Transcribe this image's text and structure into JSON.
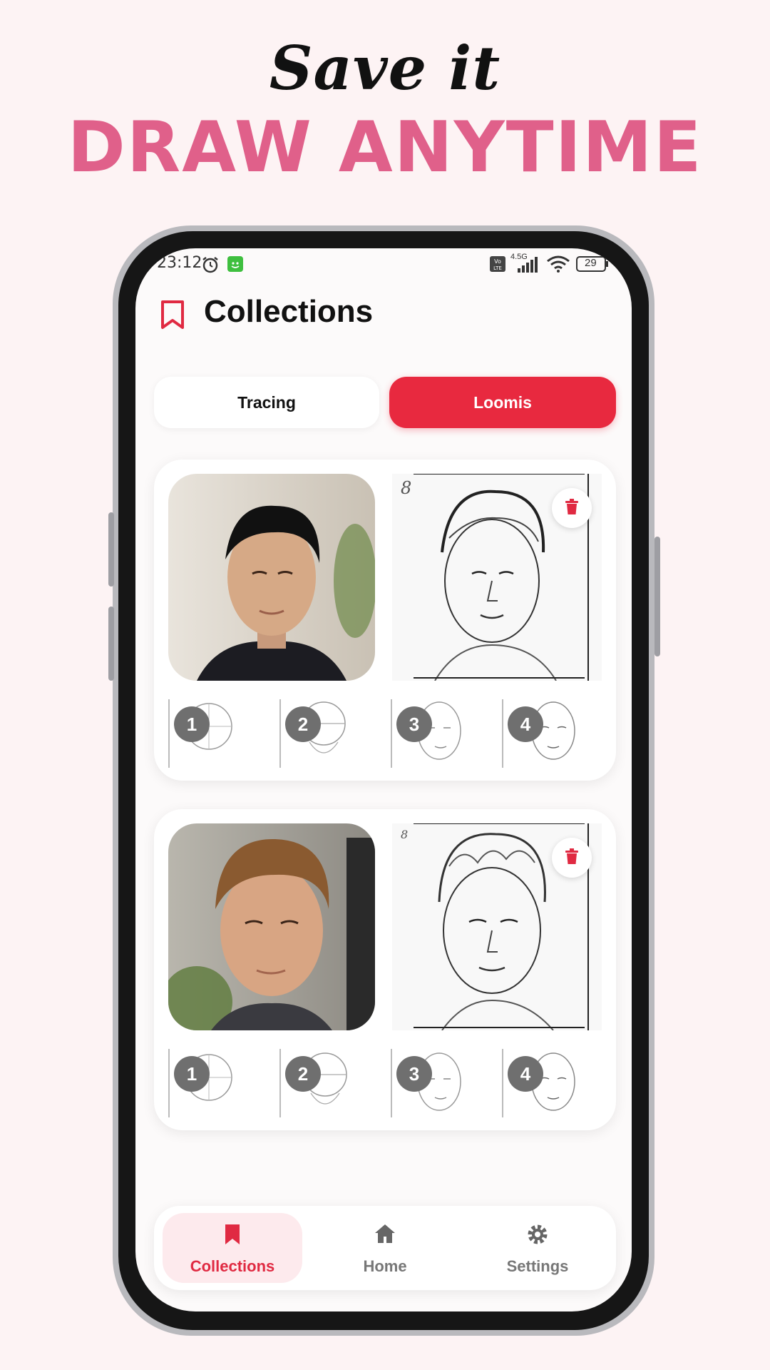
{
  "hero": {
    "script_text": "Save it",
    "title": "DRAW ANYTIME"
  },
  "status_bar": {
    "time": "23:12",
    "network": "4.5G",
    "volte": "Vo LTE",
    "battery": "29"
  },
  "header": {
    "title": "Collections",
    "icon": "bookmark-icon"
  },
  "tabs": [
    {
      "label": "Tracing",
      "active": false
    },
    {
      "label": "Loomis",
      "active": true
    }
  ],
  "collections": [
    {
      "sketch_number": "8",
      "steps": [
        "1",
        "2",
        "3",
        "4"
      ]
    },
    {
      "sketch_number": "8",
      "steps": [
        "1",
        "2",
        "3",
        "4"
      ]
    }
  ],
  "bottom_nav": [
    {
      "label": "Collections",
      "icon": "bookmark-icon",
      "active": true
    },
    {
      "label": "Home",
      "icon": "home-icon",
      "active": false
    },
    {
      "label": "Settings",
      "icon": "gear-icon",
      "active": false
    }
  ],
  "colors": {
    "accent": "#e8293f",
    "hero_pink": "#e0608a",
    "background": "#fdf3f4"
  }
}
